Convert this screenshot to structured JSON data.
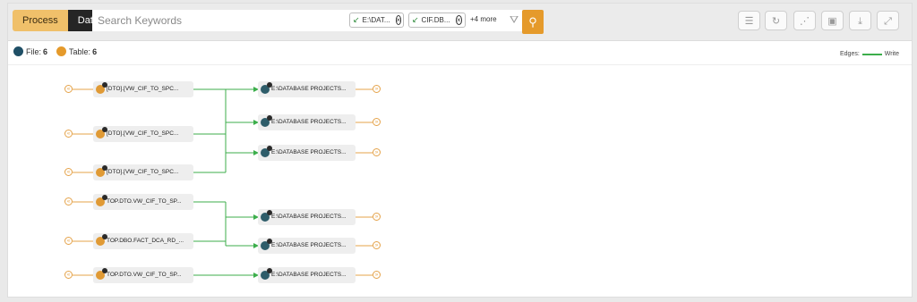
{
  "toolbar": {
    "process_label": "Process",
    "data_label": "Data",
    "search_placeholder": "Search Keywords",
    "chips": [
      "E:\\DAT...",
      "CIF.DB..."
    ],
    "more_label": "+4 more"
  },
  "stats": {
    "file_label": "File:",
    "file_count": "6",
    "table_label": "Table:",
    "table_count": "6"
  },
  "legend": {
    "prefix": "Edges:",
    "write_label": "Write",
    "write_color": "#3cae4b"
  },
  "tables": [
    "[DTO].[VW_CIF_TO_SPC...",
    "[DTO].[VW_CIF_TO_SPC...",
    "[DTO].[VW_CIF_TO_SPC...",
    "TOP.DTO.VW_CIF_TO_SP...",
    "TOP.DBO.FACT_DCA_RD_...",
    "TOP.DTO.VW_CIF_TO_SP..."
  ],
  "files": [
    "E:\\DATABASE PROJECTS...",
    "E:\\DATABASE PROJECTS...",
    "E:\\DATABASE PROJECTS...",
    "E:\\DATABASE PROJECTS...",
    "E:\\DATABASE PROJECTS...",
    "E:\\DATABASE PROJECTS..."
  ],
  "colors": {
    "accent": "#e59a2b",
    "edge": "#3cae4b",
    "table_icon": "#e09a35",
    "file_icon": "#2e5d6a"
  }
}
